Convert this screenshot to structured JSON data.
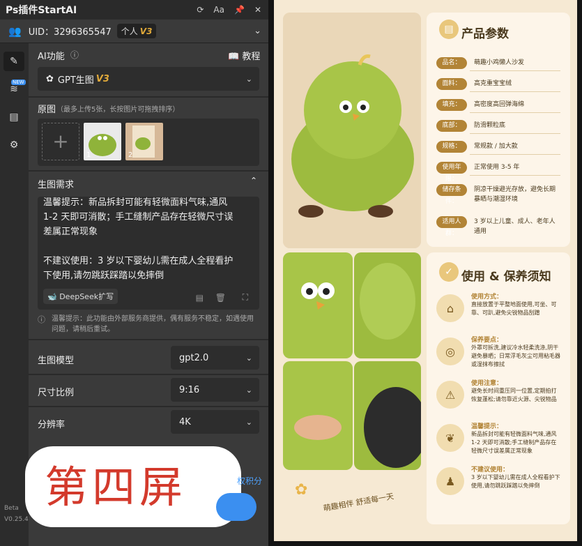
{
  "titlebar": {
    "title": "Ps插件StartAI",
    "refresh_icon": "refresh-icon",
    "font_icon": "Aa",
    "pin_icon": "pin-icon",
    "close_icon": "close-icon"
  },
  "account": {
    "uid": "UID：3296365547",
    "plan": "个人",
    "plan_version": "V3"
  },
  "rail": {
    "new_badge": "NEW"
  },
  "ai": {
    "label": "AI功能",
    "tutorial": "教程",
    "model_select": "GPT生图",
    "model_version": "V3"
  },
  "source": {
    "label": "原图",
    "hint": "（最多上传5张，长按图片可拖拽排序）",
    "thumb1": "1",
    "thumb2": "2"
  },
  "prompt": {
    "label": "生图需求",
    "lines": [
      "温馨提示：新品拆封可能有轻微面料气味,通风",
      "1-2 天即可消散；手工缝制产品存在轻微尺寸误",
      "差属正常现象",
      "",
      "不建议使用：3 岁以下婴幼儿需在成人全程看护",
      "下使用,请勿跳跃踩踏以免摔倒"
    ],
    "deepseek": "DeepSeek扩写"
  },
  "notice": "温馨提示：此功能由外部服务商提供，偶有服务不稳定，如遇使用问题，请稍后重试。",
  "settings": [
    {
      "label": "生图模型",
      "value": "gpt2.0"
    },
    {
      "label": "尺寸比例",
      "value": "9:16"
    },
    {
      "label": "分辨率",
      "value": "4K"
    }
  ],
  "overlay_text": "第四屏",
  "points_text": "权积分",
  "version": {
    "beta": "Beta",
    "ver": "V0.25.4"
  },
  "poster": {
    "params_title": "产品参数",
    "params": [
      {
        "k": "品名：",
        "v": "萌趣小鸡懒人沙发"
      },
      {
        "k": "面料：",
        "v": "高克重宝宝绒"
      },
      {
        "k": "填充：",
        "v": "高密度高回弹海绵"
      },
      {
        "k": "底部：",
        "v": "防滑颗粒底"
      },
      {
        "k": "规格：",
        "v": "常规款 / 加大款"
      },
      {
        "k": "使用年限：",
        "v": "正常使用 3-5 年"
      },
      {
        "k": "储存条件：",
        "v": "阴凉干燥避光存放，避免长期暴晒与潮湿环境"
      },
      {
        "k": "适用人群：",
        "v": "3 岁以上儿童、成人、老年人通用"
      }
    ],
    "care_title": "使用 & 保养须知",
    "care": [
      {
        "t": "使用方式：",
        "d": "直接放置于平整地面使用,可坐、可靠、可趴,避免尖锐物品刮蹭",
        "icon": "sofa-icon"
      },
      {
        "t": "保养要点：",
        "d": "外罩可拆洗,建议冷水轻柔洗涤,阴干避免暴晒；日常浮毛灰尘可用粘毛器或湿抹布擦拭",
        "icon": "washing-machine-icon"
      },
      {
        "t": "使用注意：",
        "d": "避免长时间重压同一位置,定期拍打恢复蓬松;请勿靠近火源、尖锐物品",
        "icon": "warning-icon"
      },
      {
        "t": "温馨提示：",
        "d": "新品拆封可能有轻微面料气味,通风 1-2 天即可消散;手工缝制产品存在轻微尺寸误差属正常现象",
        "icon": "leaf-icon"
      },
      {
        "t": "不建议使用：",
        "d": "3 岁以下婴幼儿需在成人全程看护下使用,请勿跳跃踩踏以免摔倒",
        "icon": "family-icon"
      }
    ],
    "slogan": "萌趣相伴 舒适每一天"
  }
}
